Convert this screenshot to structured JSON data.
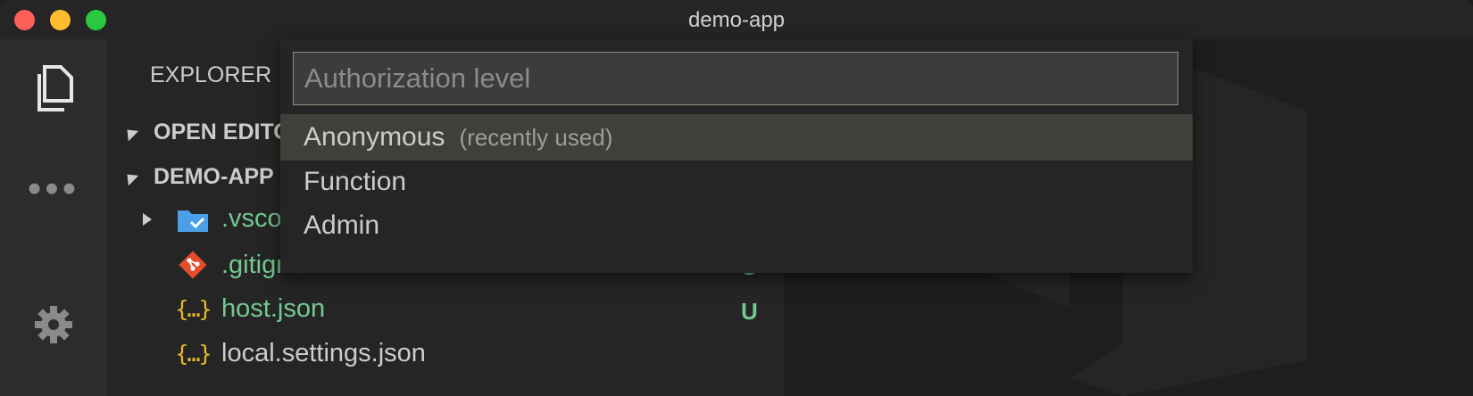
{
  "window": {
    "title": "demo-app"
  },
  "activity_bar": {
    "icons": [
      "files-icon",
      "more-icon",
      "gear-icon"
    ]
  },
  "sidebar": {
    "title": "EXPLORER",
    "sections": [
      {
        "label": "OPEN EDITORS"
      },
      {
        "label": "DEMO-APP"
      }
    ],
    "files": [
      {
        "name": ".vscode",
        "icon": "vscode-folder-icon",
        "color": "#73c991",
        "badge": ""
      },
      {
        "name": ".gitignore",
        "icon": "git-icon",
        "color": "#73c991",
        "badge": "U"
      },
      {
        "name": "host.json",
        "icon": "json-icon",
        "color": "#73c991",
        "badge": "U"
      },
      {
        "name": "local.settings.json",
        "icon": "json-icon",
        "color": "#cccccc",
        "badge": ""
      }
    ]
  },
  "quick_pick": {
    "placeholder": "Authorization level",
    "value": "",
    "items": [
      {
        "label": "Anonymous",
        "description": "(recently used)",
        "selected": true
      },
      {
        "label": "Function",
        "description": "",
        "selected": false
      },
      {
        "label": "Admin",
        "description": "",
        "selected": false
      }
    ]
  },
  "colors": {
    "git_untracked": "#73c991",
    "json_icon": "#e8b72c",
    "git_icon": "#e54d2a",
    "folder_icon": "#4a9fe6"
  }
}
